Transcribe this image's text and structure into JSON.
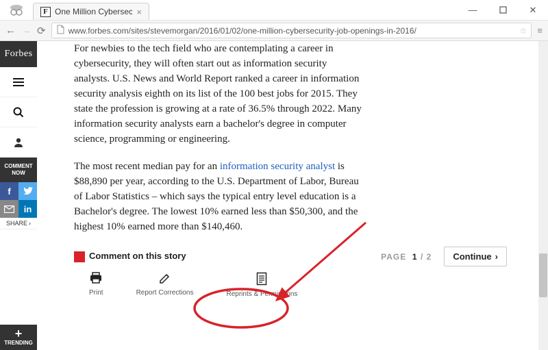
{
  "window": {
    "tab_title": "One Million Cybersecurity",
    "url": "www.forbes.com/sites/stevemorgan/2016/01/02/one-million-cybersecurity-job-openings-in-2016/"
  },
  "rail": {
    "logo": "Forbes",
    "comment_now_line1": "COMMENT",
    "comment_now_line2": "NOW",
    "share_label": "SHARE",
    "trending_label": "TRENDING"
  },
  "article": {
    "para1": "For newbies to the tech field who are contemplating a career in cybersecurity, they will often start out as information security analysts. U.S. News and World Report ranked a career in information security analysis eighth on its list of the 100 best jobs for 2015. They state the profession is growing at a rate of 36.5% through 2022. Many information security analysts earn a bachelor's degree in computer science, programming or engineering.",
    "para2_a": "The most recent median pay for an ",
    "para2_link": "information security analyst",
    "para2_b": " is $88,890 per year, according to the U.S. Department of Labor, Bureau of Labor Statistics – which says the typical entry level education is a Bachelor's degree. The lowest 10% earned less than $50,300, and the highest 10% earned more than $140,460.",
    "comment_label": "Comment on this story",
    "pager_label": "PAGE",
    "pager_current": "1",
    "pager_sep": "/",
    "pager_total": "2",
    "continue_label": "Continue",
    "actions": {
      "print": "Print",
      "report": "Report Corrections",
      "reprints": "Reprints & Permissions"
    }
  }
}
